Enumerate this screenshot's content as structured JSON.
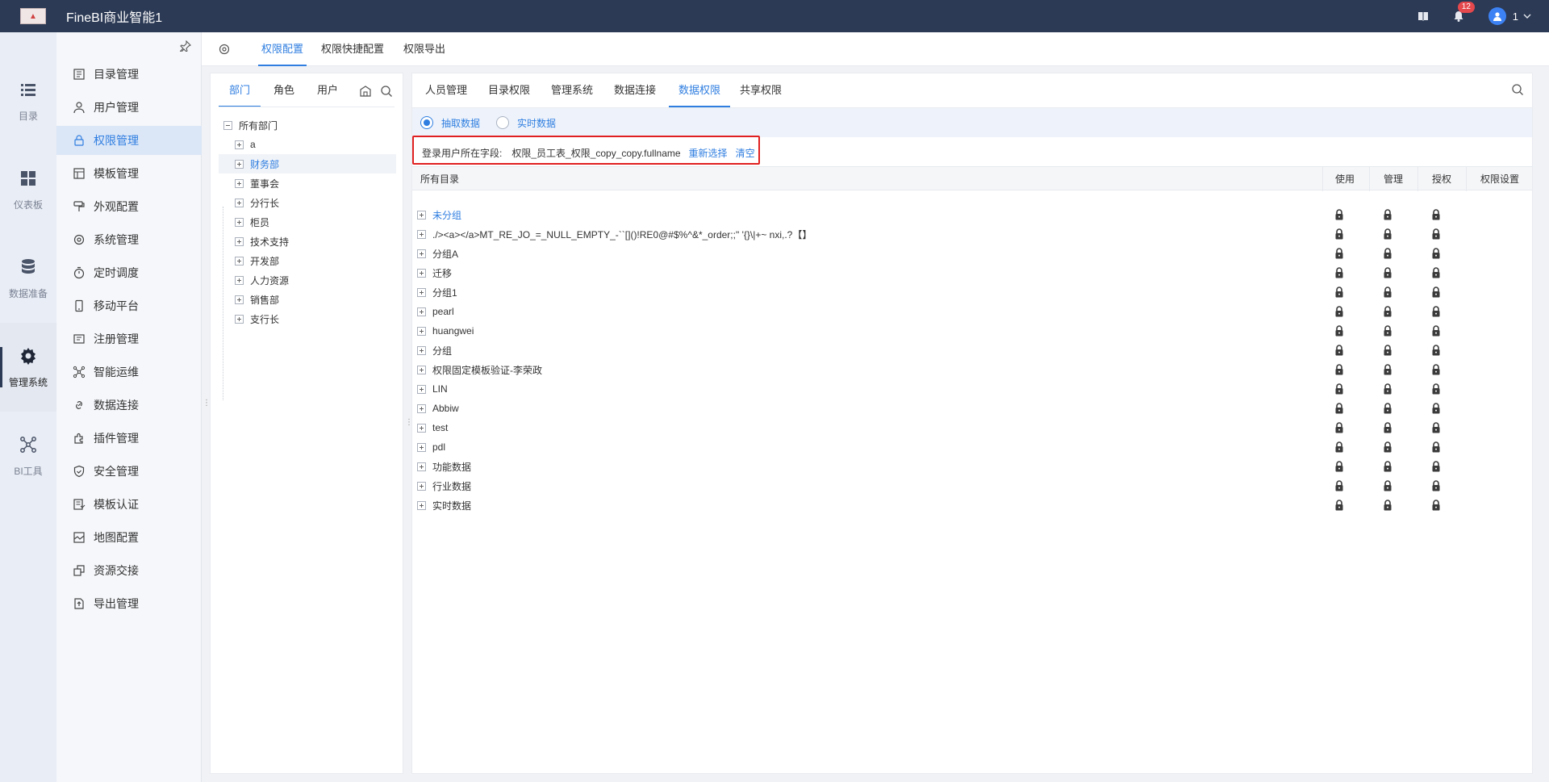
{
  "app": {
    "title": "FineBI商业智能1"
  },
  "topbar": {
    "notifications": "12",
    "user": "1"
  },
  "rail": [
    {
      "label": "目录",
      "icon": "list-icon"
    },
    {
      "label": "仪表板",
      "icon": "dashboard-icon"
    },
    {
      "label": "数据准备",
      "icon": "database-icon"
    },
    {
      "label": "管理系统",
      "icon": "gear-icon",
      "active": true
    },
    {
      "label": "BI工具",
      "icon": "network-icon"
    }
  ],
  "menu": [
    {
      "label": "目录管理",
      "icon": "catalog-icon"
    },
    {
      "label": "用户管理",
      "icon": "user-icon"
    },
    {
      "label": "权限管理",
      "icon": "lock-icon",
      "active": true
    },
    {
      "label": "模板管理",
      "icon": "template-icon"
    },
    {
      "label": "外观配置",
      "icon": "paint-icon"
    },
    {
      "label": "系统管理",
      "icon": "settings-icon"
    },
    {
      "label": "定时调度",
      "icon": "timer-icon"
    },
    {
      "label": "移动平台",
      "icon": "mobile-icon"
    },
    {
      "label": "注册管理",
      "icon": "register-icon"
    },
    {
      "label": "智能运维",
      "icon": "ops-icon"
    },
    {
      "label": "数据连接",
      "icon": "link-icon"
    },
    {
      "label": "插件管理",
      "icon": "plugin-icon"
    },
    {
      "label": "安全管理",
      "icon": "shield-icon"
    },
    {
      "label": "模板认证",
      "icon": "certify-icon"
    },
    {
      "label": "地图配置",
      "icon": "map-icon"
    },
    {
      "label": "资源交接",
      "icon": "handover-icon"
    },
    {
      "label": "导出管理",
      "icon": "export-icon"
    }
  ],
  "header_tabs": [
    "权限配置",
    "权限快捷配置",
    "权限导出"
  ],
  "org": {
    "tabs": [
      "部门",
      "角色",
      "用户"
    ],
    "root": "所有部门",
    "items": [
      "a",
      "财务部",
      "董事会",
      "分行长",
      "柜员",
      "技术支持",
      "开发部",
      "人力资源",
      "销售部",
      "支行长"
    ],
    "highlight": 1
  },
  "main": {
    "tabs": [
      "人员管理",
      "目录权限",
      "管理系统",
      "数据连接",
      "数据权限",
      "共享权限"
    ],
    "active_tab": 4,
    "radio": [
      "抽取数据",
      "实时数据"
    ],
    "field_label": "登录用户所在字段:",
    "field_value": "权限_员工表_权限_copy_copy.fullname",
    "reselect": "重新选择",
    "clear": "清空",
    "columns": [
      "所有目录",
      "使用",
      "管理",
      "授权",
      "权限设置"
    ],
    "rows": [
      "未分组",
      "./><a></a>MT_RE_JO_=_NULL_EMPTY_-``[]()!RE0@#$%^&*_order;;\"      '{}\\|+~ nxi,.?【】",
      "分组A",
      "迁移",
      "分组1",
      "pearl",
      "huangwei",
      "分组",
      "权限固定模板验证-李荣政",
      "LIN",
      "Abbiw",
      "test",
      "pdl",
      "功能数据",
      "行业数据",
      "实时数据"
    ]
  }
}
